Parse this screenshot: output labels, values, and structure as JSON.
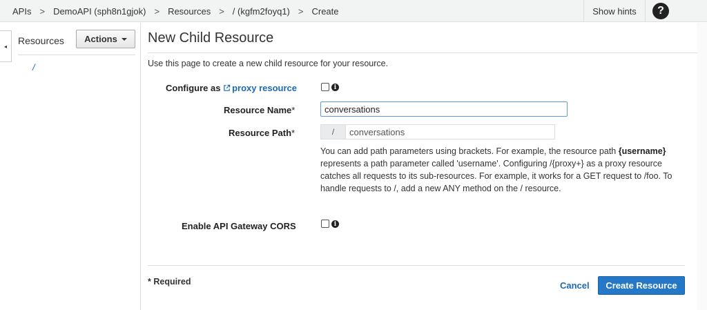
{
  "breadcrumb": {
    "items": [
      "APIs",
      "DemoAPI (sph8n1gjok)",
      "Resources",
      "/ (kgfm2foyq1)",
      "Create"
    ],
    "separator": ">"
  },
  "topbar": {
    "show_hints_label": "Show hints",
    "help_glyph": "?"
  },
  "sidebar": {
    "collapse_glyph": "◂",
    "title": "Resources",
    "actions_label": "Actions",
    "tree": [
      {
        "label": "/"
      }
    ]
  },
  "main": {
    "title": "New Child Resource",
    "intro": "Use this page to create a new child resource for your resource.",
    "proxy": {
      "label_prefix": "Configure as ",
      "link_text": "proxy resource",
      "checked": false
    },
    "resource_name": {
      "label": "Resource Name",
      "required_mark": "*",
      "value": "conversations"
    },
    "resource_path": {
      "label": "Resource Path",
      "required_mark": "*",
      "prefix": "/",
      "value": "conversations"
    },
    "help": {
      "part1": "You can add path parameters using brackets. For example, the resource path ",
      "bold1": "{username}",
      "part2": " represents a path parameter called 'username'. Configuring /{proxy+} as a proxy resource catches all requests to its sub-resources. For example, it works for a GET request to /foo. To handle requests to /, add a new ANY method on the / resource."
    },
    "cors": {
      "label": "Enable API Gateway CORS",
      "checked": false
    },
    "required_note": "* Required",
    "cancel_label": "Cancel",
    "create_label": "Create Resource"
  },
  "colors": {
    "link": "#1a6ab8",
    "primary_button": "#2478c7",
    "topbar_bg": "#f2f3f3"
  }
}
